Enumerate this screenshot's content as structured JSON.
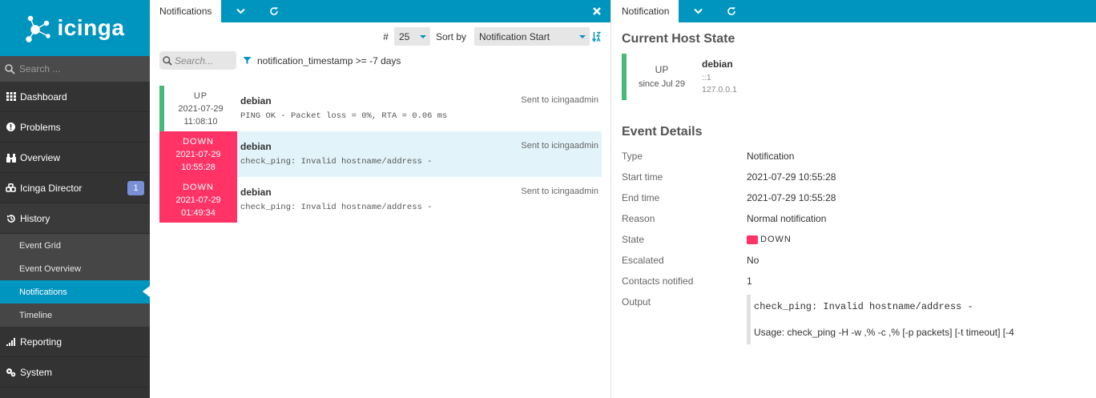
{
  "sidebar": {
    "logo_text": "icinga",
    "search_placeholder": "Search ...",
    "items": [
      {
        "label": "Dashboard",
        "icon": "dashboard-icon"
      },
      {
        "label": "Problems",
        "icon": "problems-icon"
      },
      {
        "label": "Overview",
        "icon": "binoculars-icon"
      },
      {
        "label": "Icinga Director",
        "icon": "director-icon",
        "badge": "1"
      },
      {
        "label": "History",
        "icon": "history-icon"
      },
      {
        "label": "Reporting",
        "icon": "reporting-icon"
      },
      {
        "label": "System",
        "icon": "system-icon"
      }
    ],
    "history_sub": [
      "Event Grid",
      "Event Overview",
      "Notifications",
      "Timeline"
    ]
  },
  "left": {
    "tab_label": "Notifications",
    "limit_label": "#",
    "limit_value": "25",
    "sort_label": "Sort by",
    "sort_value": "Notification Start",
    "search_placeholder": "Search...",
    "filter_text": "notification_timestamp >= -7 days",
    "rows": [
      {
        "state": "UP",
        "date": "2021-07-29",
        "time": "11:08:10",
        "host": "debian",
        "output": "PING OK - Packet loss = 0%, RTA = 0.06 ms",
        "sent": "Sent to icingaadmin"
      },
      {
        "state": "DOWN",
        "date": "2021-07-29",
        "time": "10:55:28",
        "host": "debian",
        "output": "check_ping: Invalid hostname/address -",
        "sent": "Sent to icingaadmin"
      },
      {
        "state": "DOWN",
        "date": "2021-07-29",
        "time": "01:49:34",
        "host": "debian",
        "output": "check_ping: Invalid hostname/address -",
        "sent": "Sent to icingaadmin"
      }
    ]
  },
  "right": {
    "tab_label": "Notification",
    "host_state_title": "Current Host State",
    "host_state": {
      "state": "UP",
      "since": "since Jul 29",
      "name": "debian",
      "ipv6": "::1",
      "ipv4": "127.0.0.1"
    },
    "event_title": "Event Details",
    "details": [
      {
        "label": "Type",
        "value": "Notification"
      },
      {
        "label": "Start time",
        "value": "2021-07-29 10:55:28"
      },
      {
        "label": "End time",
        "value": "2021-07-29 10:55:28"
      },
      {
        "label": "Reason",
        "value": "Normal notification"
      },
      {
        "label": "State",
        "value": "DOWN"
      },
      {
        "label": "Escalated",
        "value": "No"
      },
      {
        "label": "Contacts notified",
        "value": "1"
      },
      {
        "label": "Output",
        "value": ""
      }
    ],
    "output_line1": "check_ping: Invalid hostname/address -",
    "output_line2": "Usage: check_ping -H -w ,% -c ,% [-p packets] [-t timeout] [-4"
  },
  "colors": {
    "brand": "#0095bf",
    "up": "#44bb77",
    "down": "#ff3366",
    "sidebar": "#333333"
  }
}
